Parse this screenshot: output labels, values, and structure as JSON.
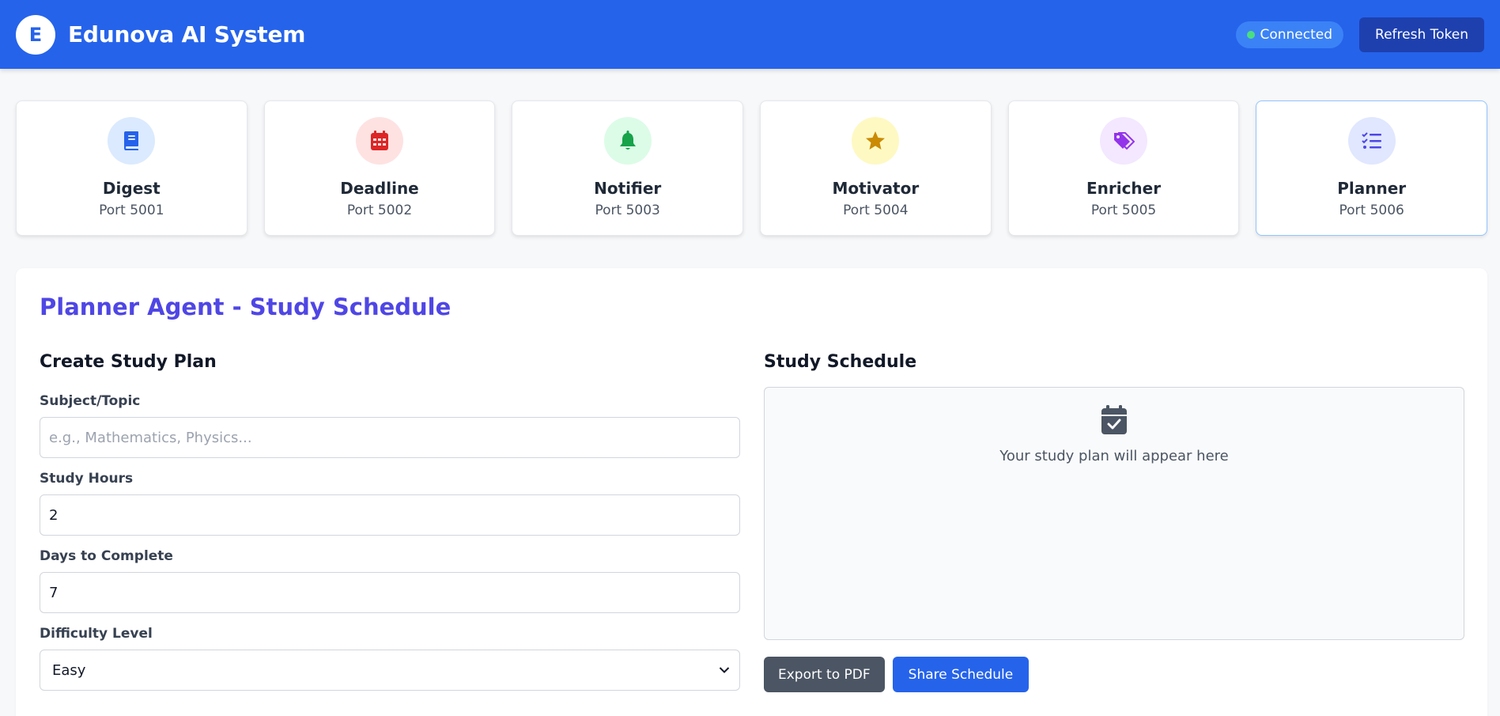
{
  "header": {
    "logo_letter": "E",
    "title": "Edunova AI System",
    "status": "Connected",
    "refresh_label": "Refresh Token"
  },
  "agents": [
    {
      "name": "Digest",
      "port": "Port 5001",
      "icon": "book-icon",
      "bg": "#dbeafe",
      "fg": "#2563eb"
    },
    {
      "name": "Deadline",
      "port": "Port 5002",
      "icon": "calendar-icon",
      "bg": "#fee2e2",
      "fg": "#dc2626"
    },
    {
      "name": "Notifier",
      "port": "Port 5003",
      "icon": "bell-icon",
      "bg": "#dcfce7",
      "fg": "#16a34a"
    },
    {
      "name": "Motivator",
      "port": "Port 5004",
      "icon": "star-icon",
      "bg": "#fef9c3",
      "fg": "#ca8a04"
    },
    {
      "name": "Enricher",
      "port": "Port 5005",
      "icon": "tags-icon",
      "bg": "#f3e8ff",
      "fg": "#9333ea"
    },
    {
      "name": "Planner",
      "port": "Port 5006",
      "icon": "list-check-icon",
      "bg": "#e0e7ff",
      "fg": "#4f46e5"
    }
  ],
  "planner": {
    "title": "Planner Agent - Study Schedule",
    "form": {
      "section_title": "Create Study Plan",
      "subject_label": "Subject/Topic",
      "subject_placeholder": "e.g., Mathematics, Physics...",
      "hours_label": "Study Hours",
      "hours_value": "2",
      "days_label": "Days to Complete",
      "days_value": "7",
      "difficulty_label": "Difficulty Level",
      "difficulty_value": "Easy"
    },
    "schedule": {
      "section_title": "Study Schedule",
      "empty_text": "Your study plan will appear here",
      "export_label": "Export to PDF",
      "share_label": "Share Schedule"
    }
  },
  "colors": {
    "brand": "#2563eb",
    "accent": "#4f46e5",
    "status_dot": "#4ade80"
  }
}
